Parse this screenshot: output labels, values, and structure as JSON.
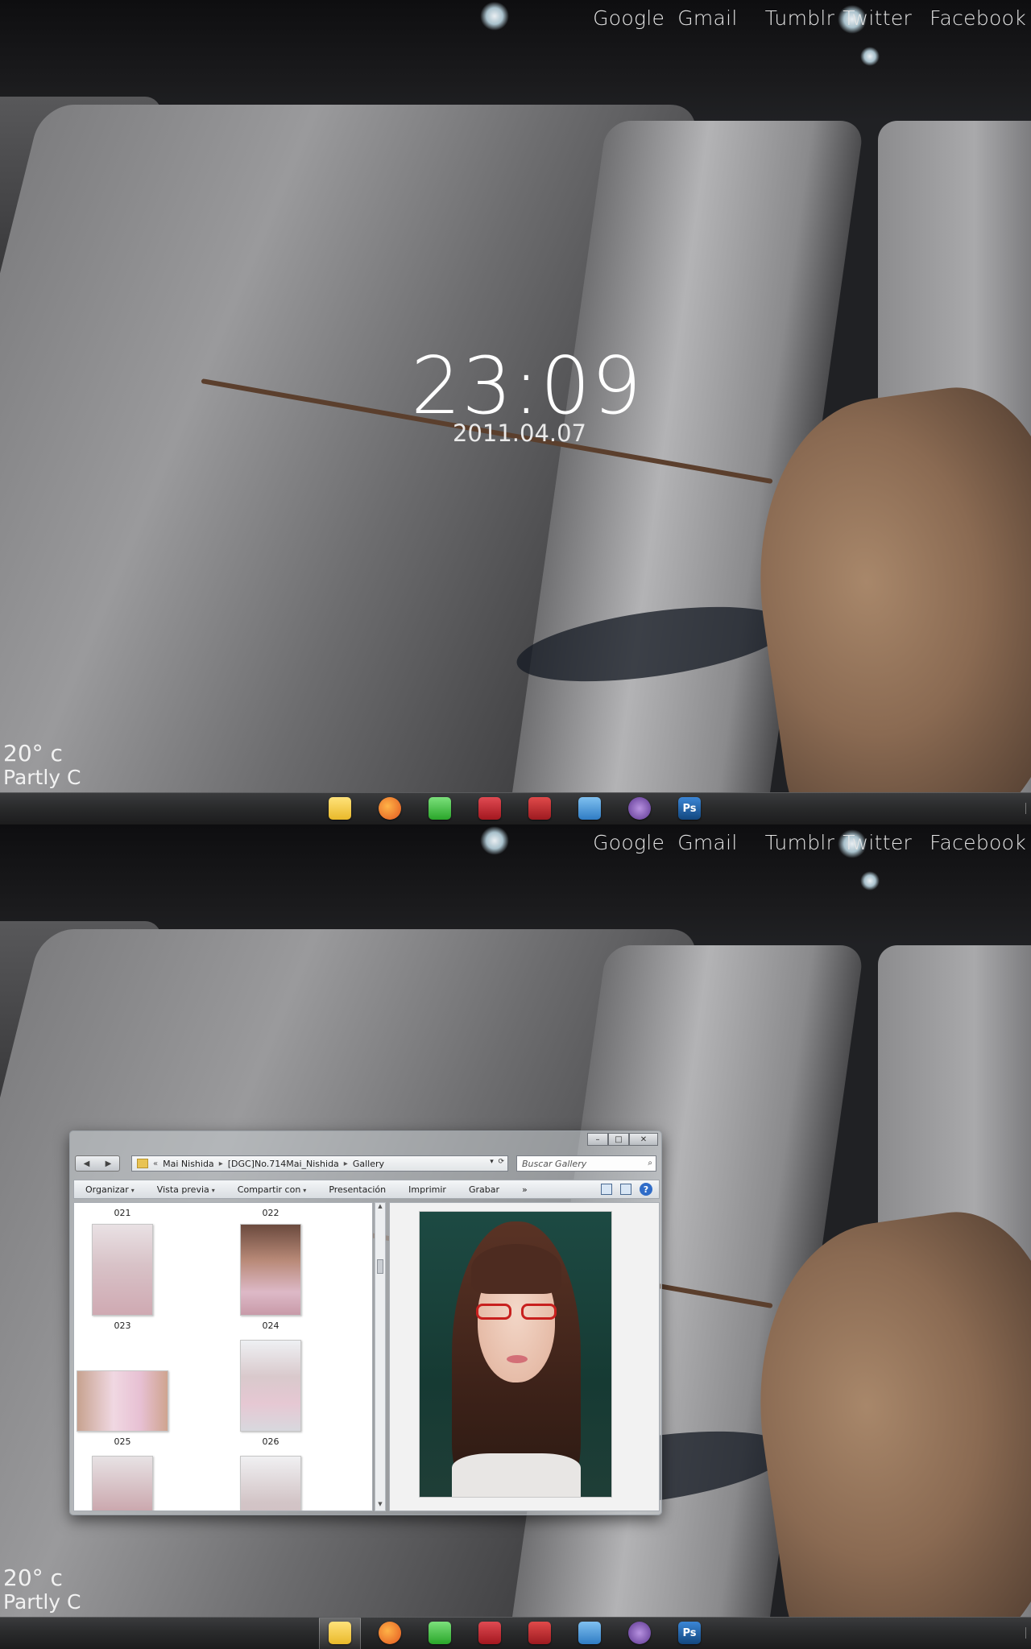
{
  "links": [
    "Google",
    "Gmail",
    "Tumblr",
    "Twitter",
    "Facebook"
  ],
  "clock": {
    "time": "23:09",
    "date": "2011.04.07"
  },
  "weather": {
    "temp": "20° c",
    "condition": "Partly C"
  },
  "dock": {
    "apps": [
      {
        "icon": "folder-icon",
        "color": "#e9b92a"
      },
      {
        "icon": "firefox-icon",
        "color": "#e2561f"
      },
      {
        "icon": "messenger-icon",
        "color": "#2aa62a"
      },
      {
        "icon": "eye-icon",
        "color": "#c3212a"
      },
      {
        "icon": "acrobat-icon",
        "color": "#c0272d"
      },
      {
        "icon": "chat-icon",
        "color": "#3c8fd6"
      },
      {
        "icon": "itunes-icon",
        "color": "#7a4fb0"
      },
      {
        "icon": "photoshop-icon",
        "color": "#1c5fa8",
        "text": "Ps"
      }
    ]
  },
  "explorer": {
    "breadcrumb": [
      "Mai Nishida",
      "[DGC]No.714Mai_Nishida",
      "Gallery"
    ],
    "breadcrumb_prefix": "«",
    "search_placeholder": "Buscar Gallery",
    "toolbar": [
      "Organizar",
      "Vista previa",
      "Compartir con",
      "Presentación",
      "Imprimir",
      "Grabar"
    ],
    "files": [
      {
        "label": "021"
      },
      {
        "label": "022"
      },
      {
        "label": "023"
      },
      {
        "label": "024"
      },
      {
        "label": "025"
      },
      {
        "label": "026"
      }
    ]
  }
}
